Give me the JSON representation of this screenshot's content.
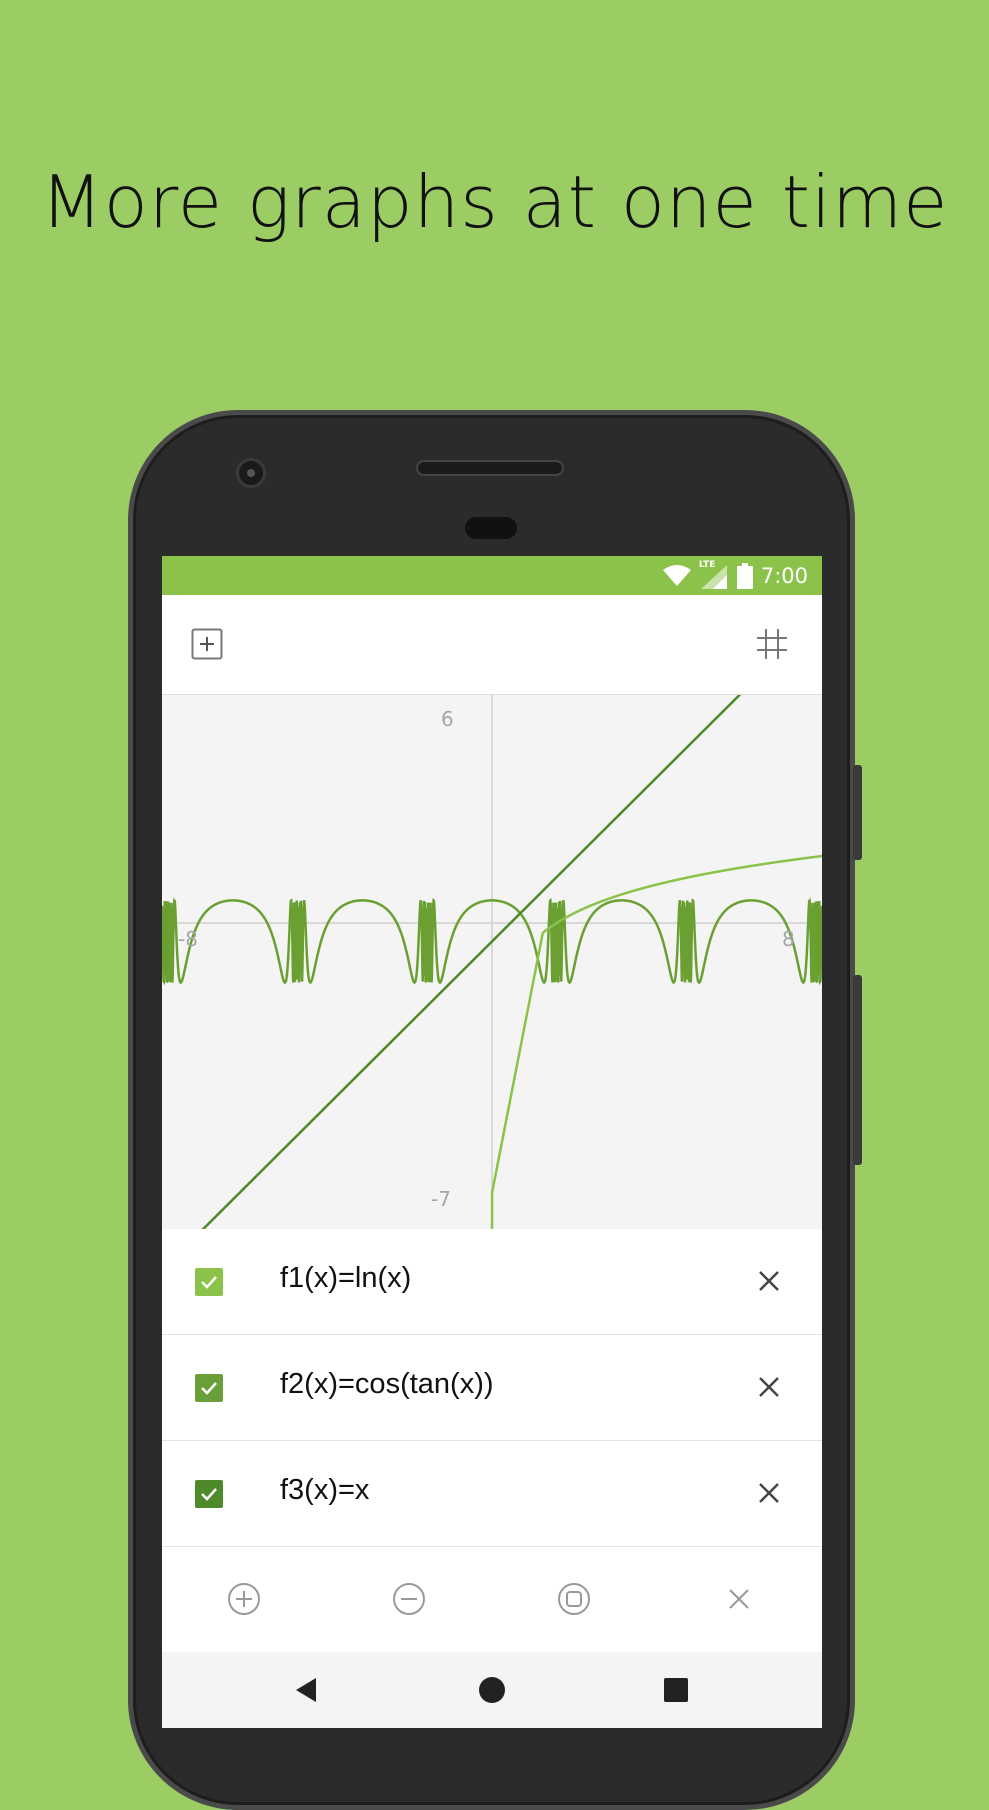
{
  "headline": "More graphs at one time",
  "status_bar": {
    "time": "7:00",
    "network_label": "LTE",
    "icons": [
      "wifi-icon",
      "lte-signal-icon",
      "battery-icon"
    ]
  },
  "toolbar": {
    "left_icon": "add-square-icon",
    "right_icon": "grid-icon"
  },
  "graph": {
    "y_max_label": "6",
    "y_min_label": "-7",
    "x_min_label": "-8",
    "x_max_label": "8"
  },
  "chart_data": {
    "type": "line",
    "x_range": [
      -8,
      8
    ],
    "y_range": [
      -7,
      6
    ],
    "series": [
      {
        "name": "f1(x)=ln(x)",
        "color": "#8bc34a"
      },
      {
        "name": "f2(x)=cos(tan(x))",
        "color": "#6aa032"
      },
      {
        "name": "f3(x)=x",
        "color": "#4d8a26"
      }
    ]
  },
  "functions": [
    {
      "label": "f1(x)=ln(x)",
      "checked": true,
      "color": "#8bc34a"
    },
    {
      "label": "f2(x)=cos(tan(x))",
      "checked": true,
      "color": "#689f38"
    },
    {
      "label": "f3(x)=x",
      "checked": true,
      "color": "#4e8a29"
    }
  ],
  "tools": [
    "zoom-in-icon",
    "zoom-out-icon",
    "fit-screen-icon",
    "clear-icon"
  ],
  "nav": [
    "back-icon",
    "home-icon",
    "recents-icon"
  ],
  "colors": {
    "background": "#9ccd65",
    "accent": "#8bc34a"
  }
}
